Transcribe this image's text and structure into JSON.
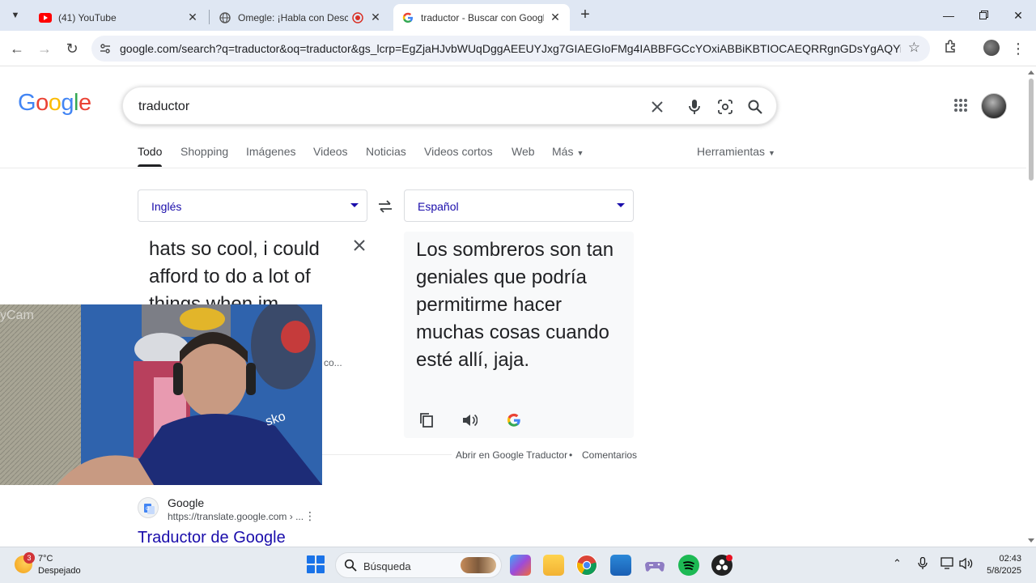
{
  "browser": {
    "tabs": [
      {
        "title": "(41) YouTube",
        "icon": "youtube-icon",
        "active": false
      },
      {
        "title": "Omegle: ¡Habla con Descon",
        "icon": "globe-icon",
        "active": false
      },
      {
        "title": "traductor - Buscar con Google",
        "icon": "google-icon",
        "active": true
      }
    ],
    "url": "google.com/search?q=traductor&oq=traductor&gs_lcrp=EgZjaHJvbWUqDggAEEUYJxg7GIAEGIoFMg4IABBFGCcYOxiABBiKBTIOCAEQRRgnGDsYgAQYigUyCggCEAA..."
  },
  "google": {
    "logo": [
      "G",
      "o",
      "o",
      "g",
      "l",
      "e"
    ],
    "logo_colors": [
      "#4285f4",
      "#ea4335",
      "#fbbc05",
      "#4285f4",
      "#34a853",
      "#ea4335"
    ],
    "query": "traductor",
    "nav_tabs": [
      "Todo",
      "Shopping",
      "Imágenes",
      "Videos",
      "Noticias",
      "Videos cortos",
      "Web",
      "Más"
    ],
    "tools_label": "Herramientas"
  },
  "translator": {
    "source_lang": "Inglés",
    "target_lang": "Español",
    "source_text": "hats so cool, i could afford to do a lot of things when im",
    "source_more": "co...",
    "target_text": "Los sombreros son tan geniales que podría permitirme hacer muchas cosas cuando esté allí, jaja.",
    "footer_open": "Abrir en Google Traductor",
    "footer_sep": "•",
    "footer_feedback": "Comentarios"
  },
  "result": {
    "site": "Google",
    "url": "https://translate.google.com › ...",
    "title": "Traductor de Google"
  },
  "webcam": {
    "caption": "yCam"
  },
  "taskbar": {
    "weather_badge": "3",
    "temperature": "7°C",
    "condition": "Despejado",
    "search_label": "Búsqueda",
    "time": "02:43",
    "date": "5/8/2025"
  }
}
